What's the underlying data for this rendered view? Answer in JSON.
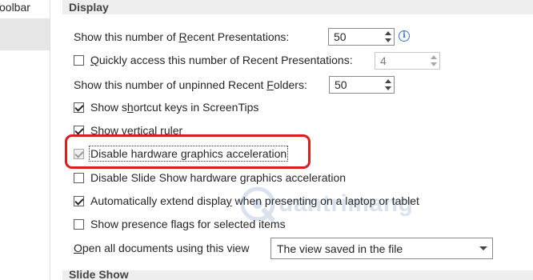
{
  "sidebar": {
    "top_item_label": "Toolbar"
  },
  "display_section": {
    "header": "Display"
  },
  "slideshow_section": {
    "header": "Slide Show"
  },
  "recent_presentations": {
    "label_pre": "Show this number of ",
    "label_accel": "R",
    "label_post": "ecent Presentations:",
    "value": "50"
  },
  "quick_access": {
    "label_accel": "Q",
    "label_post": "uickly access this number of Recent Presentations:",
    "checked": false,
    "value": "4"
  },
  "recent_folders": {
    "label_pre": "Show this number of unpinned Recent ",
    "label_accel": "F",
    "label_post": "olders:",
    "value": "50"
  },
  "shortcut_keys": {
    "label_pre": "Show s",
    "label_accel": "h",
    "label_post": "ortcut keys in ScreenTips",
    "checked": true
  },
  "vertical_ruler": {
    "label_pre": "Show ",
    "label_accel": "v",
    "label_post": "ertical ruler",
    "checked": true
  },
  "hw_accel": {
    "label_pre": "Disable hardware ",
    "label_accel": "g",
    "label_post": "raphics acceleration",
    "checked": true
  },
  "slideshow_hw_accel": {
    "label_pre": "Disable Slide Show hardware ",
    "label_accel": "g",
    "label_post": "raphics acceleration",
    "checked": false
  },
  "auto_extend": {
    "label_pre": "Automatically extend displa",
    "label_accel": "y",
    "label_post": " when presenting on a laptop or tablet",
    "checked": true
  },
  "presence_flags": {
    "label": "Show presence flags for selected items",
    "checked": false
  },
  "open_view": {
    "label_pre": "",
    "label_accel": "O",
    "label_post": "pen all documents using this view",
    "selected": "The view saved in the file"
  },
  "icons": {
    "info": "info-icon",
    "watermark": "quantrimang-logo"
  },
  "watermark_text": "uantrimang",
  "colors": {
    "highlight": "#e01b1b",
    "info": "#3c74c5",
    "header_bg": "#eeeeee"
  }
}
